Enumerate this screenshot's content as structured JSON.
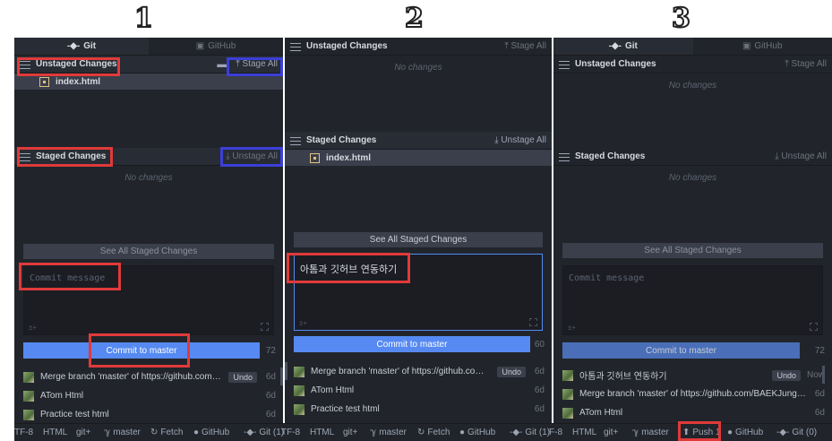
{
  "steps": [
    "1",
    "2",
    "3"
  ],
  "tabs": {
    "git": "Git",
    "github": "GitHub"
  },
  "unstaged": {
    "title": "Unstaged Changes",
    "action": "Stage All"
  },
  "staged": {
    "title": "Staged Changes",
    "action": "Unstage All"
  },
  "file": "index.html",
  "no_changes": "No changes",
  "see_all": "See All Staged Changes",
  "commit": {
    "placeholder": "Commit message",
    "typed_message": "아톰과 깃허브 연동하기",
    "button": "Commit to master",
    "count_empty": "72",
    "count_typed": "60",
    "co_author": "±+"
  },
  "commits_before": [
    {
      "message": "Merge branch 'master' of https://github.com/BA...",
      "time": "6d",
      "undo": "Undo"
    },
    {
      "message": "ATom Html",
      "time": "6d"
    },
    {
      "message": "Practice test html",
      "time": "6d"
    }
  ],
  "commits_after": [
    {
      "message": "아톰과 깃허브 연동하기",
      "time": "Now",
      "undo": "Undo"
    },
    {
      "message": "Merge branch 'master' of https://github.com/BAEKJungH...",
      "time": "6d"
    },
    {
      "message": "ATom Html",
      "time": "6d"
    }
  ],
  "status": {
    "encoding_1": "TF-8",
    "encoding_2": "TF-8",
    "encoding_3": "F-8",
    "grammar": "HTML",
    "git_plus": "git+",
    "branch": "master",
    "fetch": "Fetch",
    "push": "Push 1",
    "github": "GitHub",
    "git_1": "Git (1)",
    "git_3": "Git (0)"
  },
  "colors": {
    "background": "#21252b",
    "accent_blue": "#568af2",
    "highlight_red": "#e03a3a",
    "highlight_blue": "#3b3fd8"
  }
}
